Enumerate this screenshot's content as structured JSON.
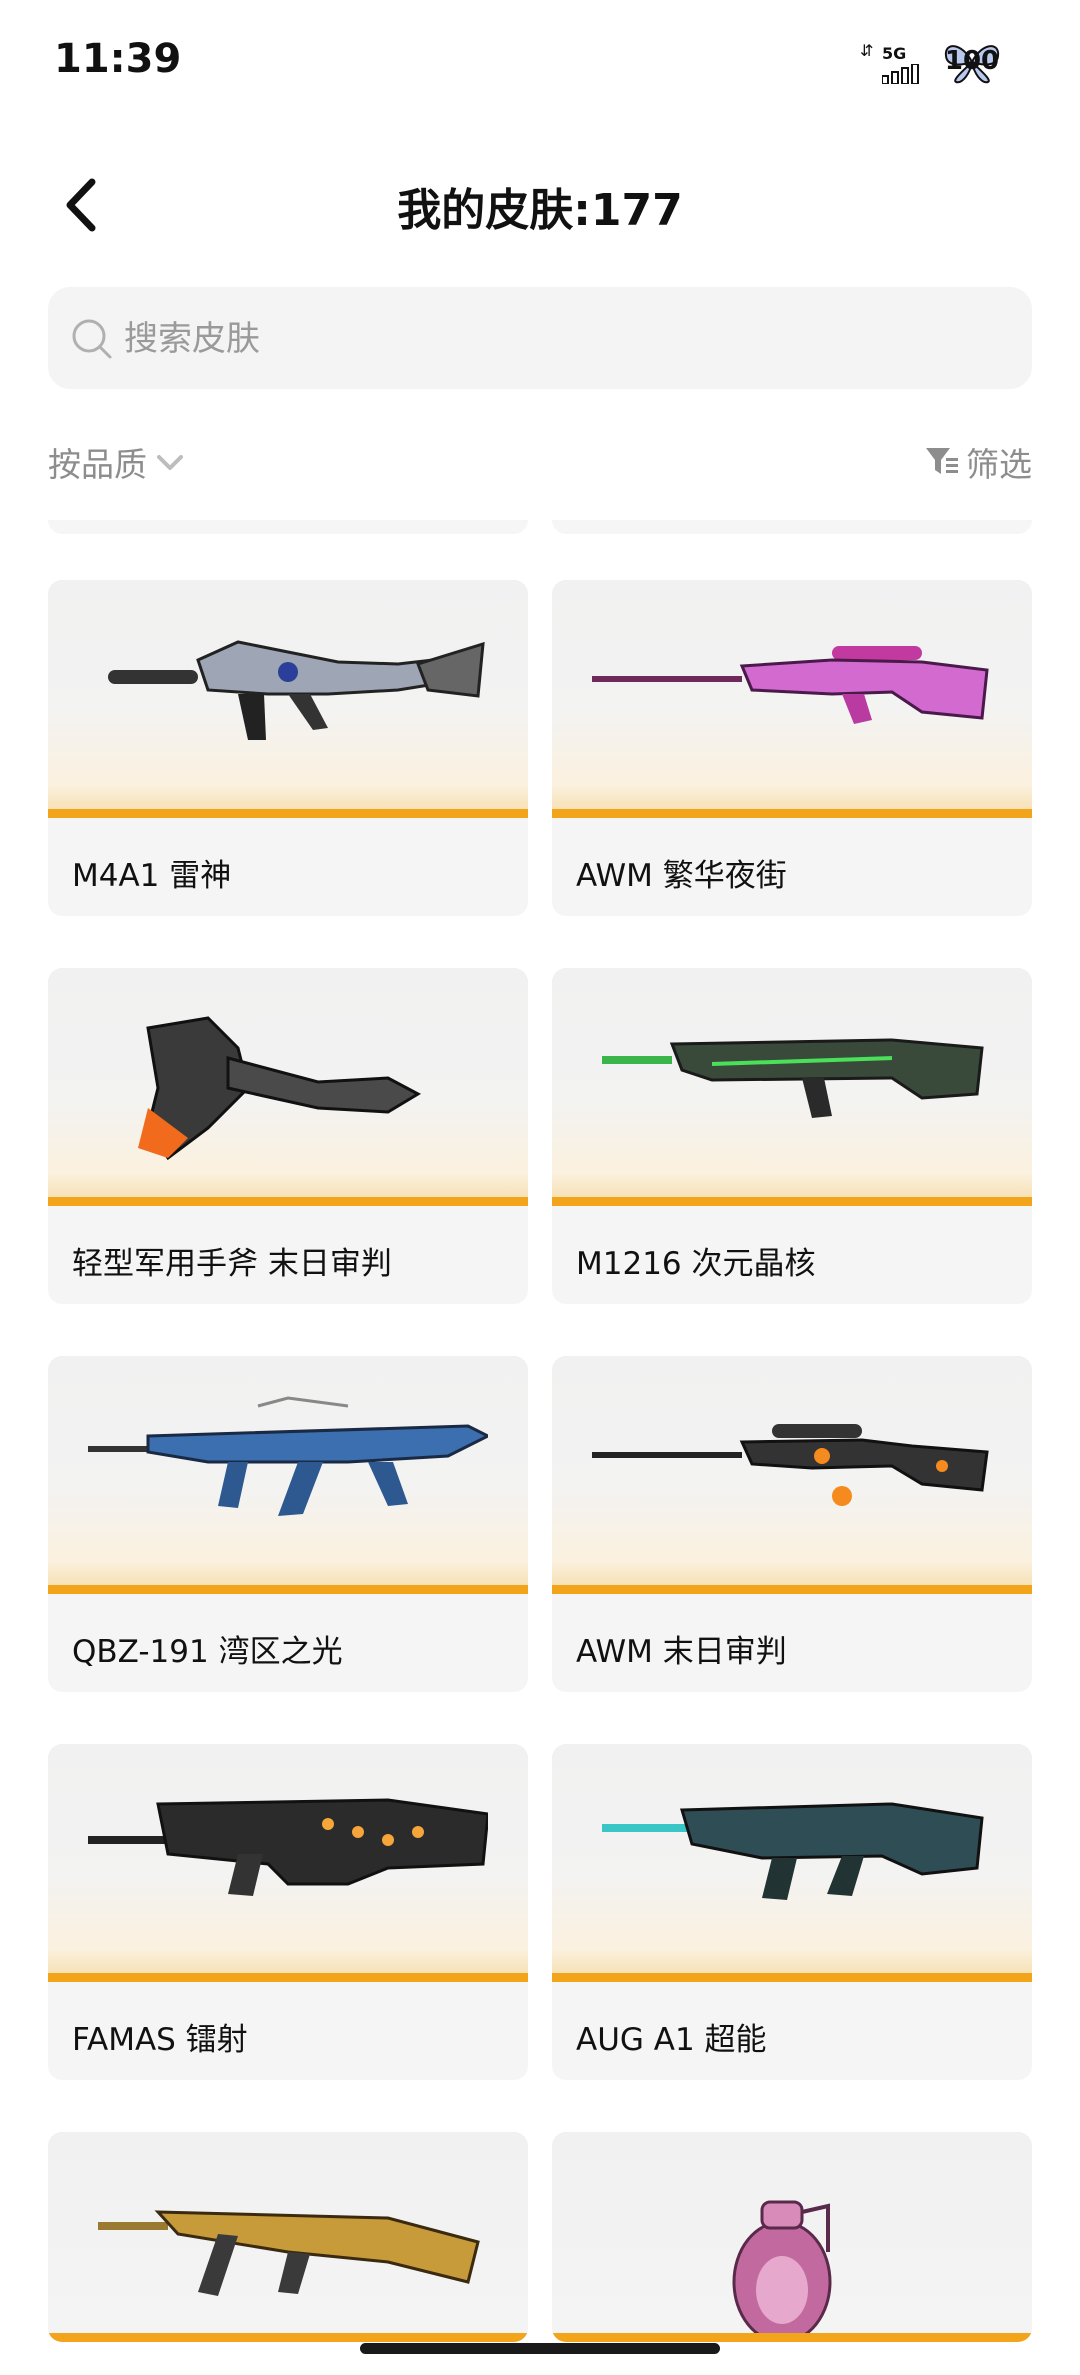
{
  "status_bar": {
    "time": "11:39",
    "network": "5G",
    "battery": "100"
  },
  "header": {
    "title": "我的皮肤:177"
  },
  "search": {
    "placeholder": "搜索皮肤",
    "value": ""
  },
  "toolbar": {
    "sort_label": "按品质",
    "filter_label": "筛选"
  },
  "colors": {
    "accent": "#f2a51a",
    "card_bg": "#f5f5f5"
  },
  "skins": [
    {
      "name": "M4A1 雷神",
      "icon": "rifle-icon"
    },
    {
      "name": "AWM 繁华夜街",
      "icon": "sniper-rifle-icon"
    },
    {
      "name": "轻型军用手斧 末日审判",
      "icon": "axe-icon"
    },
    {
      "name": "M1216 次元晶核",
      "icon": "shotgun-icon"
    },
    {
      "name": "QBZ-191 湾区之光",
      "icon": "rifle-icon"
    },
    {
      "name": "AWM  末日审判",
      "icon": "sniper-rifle-icon"
    },
    {
      "name": "FAMAS 镭射",
      "icon": "rifle-icon"
    },
    {
      "name": "AUG A1 超能",
      "icon": "rifle-icon"
    },
    {
      "name": "",
      "icon": "rifle-icon"
    },
    {
      "name": "",
      "icon": "grenade-icon"
    }
  ]
}
